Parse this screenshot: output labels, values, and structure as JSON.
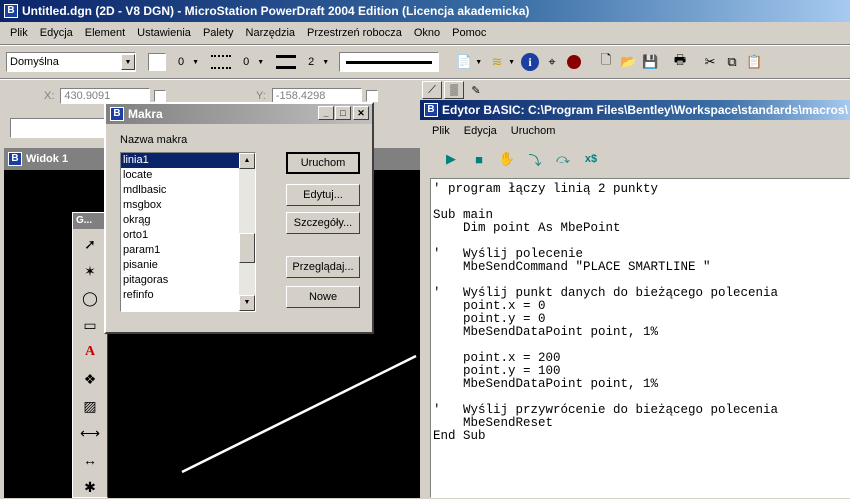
{
  "app": {
    "title": "Untitled.dgn (2D - V8 DGN) - MicroStation PowerDraft 2004 Edition (Licencja akademicka)",
    "icon_glyph": "B"
  },
  "menu": [
    "Plik",
    "Edycja",
    "Element",
    "Ustawienia",
    "Palety",
    "Narzędzia",
    "Przestrzeń robocza",
    "Okno",
    "Pomoc"
  ],
  "toolbar": {
    "level_value": "Domyślna",
    "color_value": "0",
    "style_value": "0",
    "weight_value": "2"
  },
  "coords": {
    "x_label": "X:",
    "x_value": "430.9091",
    "y_label": "Y:",
    "y_value": "-158.4298"
  },
  "view": {
    "title": "Widok 1"
  },
  "palette": {
    "title": "G..."
  },
  "macros_dialog": {
    "title": "Makra",
    "list_label": "Nazwa makra",
    "items": [
      "linia1",
      "locate",
      "mdlbasic",
      "msgbox",
      "okrąg",
      "orto1",
      "param1",
      "pisanie",
      "pitagoras",
      "refinfo"
    ],
    "selected": "linia1",
    "buttons": {
      "run": "Uruchom",
      "edit": "Edytuj...",
      "details": "Szczegóły...",
      "browse": "Przeglądaj...",
      "new": "Nowe"
    }
  },
  "editor": {
    "title": "Edytor BASIC: C:\\Program Files\\Bentley\\Workspace\\standards\\macros\\",
    "menu": [
      "Plik",
      "Edycja",
      "Uruchom"
    ],
    "code": "' program łączy linią 2 punkty\n\nSub main\n    Dim point As MbePoint\n\n'   Wyślij polecenie\n    MbeSendCommand \"PLACE SMARTLINE \"\n\n'   Wyślij punkt danych do bieżącego polecenia\n    point.x = 0\n    point.y = 0\n    MbeSendDataPoint point, 1%\n\n    point.x = 200\n    point.y = 100\n    MbeSendDataPoint point, 1%\n\n'   Wyślij przywrócenie do bieżącego polecenia\n    MbeSendReset\nEnd Sub"
  }
}
